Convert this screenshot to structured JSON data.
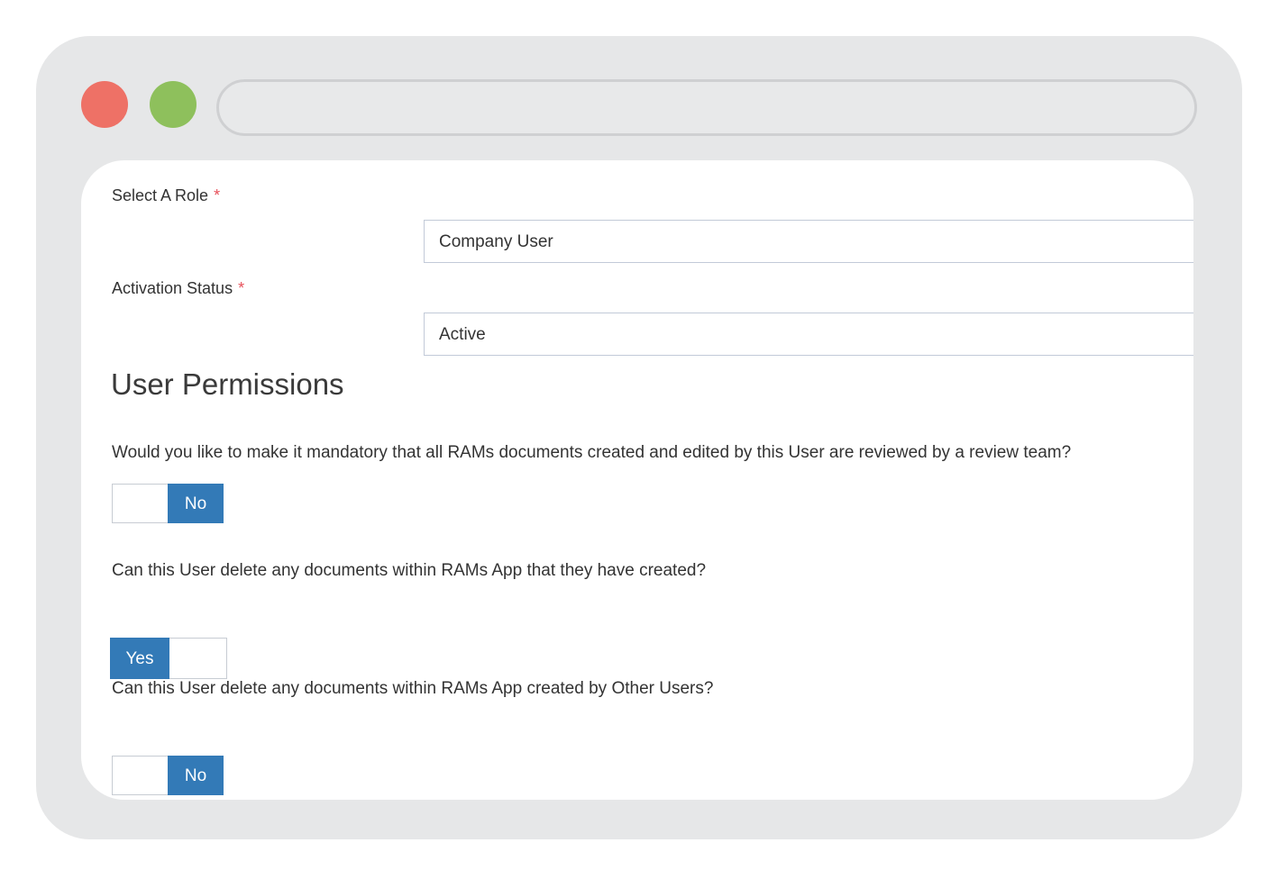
{
  "window": {
    "colors": {
      "frame": "#e6e7e8",
      "close_dot": "#ee7166",
      "min_dot": "#8ec05c",
      "toggle_active": "#337ab7",
      "required_mark": "#e7505a"
    },
    "address_bar": {
      "value": ""
    }
  },
  "form": {
    "role": {
      "label": "Select A Role",
      "required_mark": "*",
      "value": "Company User"
    },
    "activation": {
      "label": "Activation Status",
      "required_mark": "*",
      "value": "Active"
    }
  },
  "permissions": {
    "title": "User Permissions",
    "items": [
      {
        "question": "Would you like to make it mandatory that all RAMs documents created and edited by this User are reviewed by a review team?",
        "toggle_label": "No",
        "state": "off"
      },
      {
        "question": "Can this User delete any documents within RAMs App that they have created?",
        "toggle_label": "Yes",
        "state": "on"
      },
      {
        "question": "Can this User delete any documents within RAMs App created by Other Users?",
        "toggle_label": "No",
        "state": "off"
      }
    ]
  }
}
